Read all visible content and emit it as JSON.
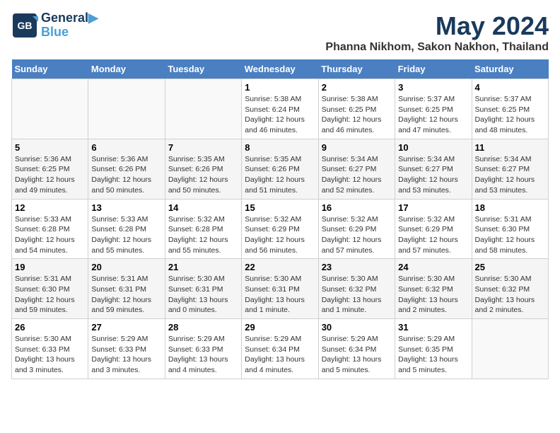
{
  "logo": {
    "text1": "General",
    "text2": "Blue"
  },
  "title": "May 2024",
  "location": "Phanna Nikhom, Sakon Nakhon, Thailand",
  "weekdays": [
    "Sunday",
    "Monday",
    "Tuesday",
    "Wednesday",
    "Thursday",
    "Friday",
    "Saturday"
  ],
  "weeks": [
    [
      {
        "day": "",
        "info": ""
      },
      {
        "day": "",
        "info": ""
      },
      {
        "day": "",
        "info": ""
      },
      {
        "day": "1",
        "info": "Sunrise: 5:38 AM\nSunset: 6:24 PM\nDaylight: 12 hours\nand 46 minutes."
      },
      {
        "day": "2",
        "info": "Sunrise: 5:38 AM\nSunset: 6:25 PM\nDaylight: 12 hours\nand 46 minutes."
      },
      {
        "day": "3",
        "info": "Sunrise: 5:37 AM\nSunset: 6:25 PM\nDaylight: 12 hours\nand 47 minutes."
      },
      {
        "day": "4",
        "info": "Sunrise: 5:37 AM\nSunset: 6:25 PM\nDaylight: 12 hours\nand 48 minutes."
      }
    ],
    [
      {
        "day": "5",
        "info": "Sunrise: 5:36 AM\nSunset: 6:25 PM\nDaylight: 12 hours\nand 49 minutes."
      },
      {
        "day": "6",
        "info": "Sunrise: 5:36 AM\nSunset: 6:26 PM\nDaylight: 12 hours\nand 50 minutes."
      },
      {
        "day": "7",
        "info": "Sunrise: 5:35 AM\nSunset: 6:26 PM\nDaylight: 12 hours\nand 50 minutes."
      },
      {
        "day": "8",
        "info": "Sunrise: 5:35 AM\nSunset: 6:26 PM\nDaylight: 12 hours\nand 51 minutes."
      },
      {
        "day": "9",
        "info": "Sunrise: 5:34 AM\nSunset: 6:27 PM\nDaylight: 12 hours\nand 52 minutes."
      },
      {
        "day": "10",
        "info": "Sunrise: 5:34 AM\nSunset: 6:27 PM\nDaylight: 12 hours\nand 53 minutes."
      },
      {
        "day": "11",
        "info": "Sunrise: 5:34 AM\nSunset: 6:27 PM\nDaylight: 12 hours\nand 53 minutes."
      }
    ],
    [
      {
        "day": "12",
        "info": "Sunrise: 5:33 AM\nSunset: 6:28 PM\nDaylight: 12 hours\nand 54 minutes."
      },
      {
        "day": "13",
        "info": "Sunrise: 5:33 AM\nSunset: 6:28 PM\nDaylight: 12 hours\nand 55 minutes."
      },
      {
        "day": "14",
        "info": "Sunrise: 5:32 AM\nSunset: 6:28 PM\nDaylight: 12 hours\nand 55 minutes."
      },
      {
        "day": "15",
        "info": "Sunrise: 5:32 AM\nSunset: 6:29 PM\nDaylight: 12 hours\nand 56 minutes."
      },
      {
        "day": "16",
        "info": "Sunrise: 5:32 AM\nSunset: 6:29 PM\nDaylight: 12 hours\nand 57 minutes."
      },
      {
        "day": "17",
        "info": "Sunrise: 5:32 AM\nSunset: 6:29 PM\nDaylight: 12 hours\nand 57 minutes."
      },
      {
        "day": "18",
        "info": "Sunrise: 5:31 AM\nSunset: 6:30 PM\nDaylight: 12 hours\nand 58 minutes."
      }
    ],
    [
      {
        "day": "19",
        "info": "Sunrise: 5:31 AM\nSunset: 6:30 PM\nDaylight: 12 hours\nand 59 minutes."
      },
      {
        "day": "20",
        "info": "Sunrise: 5:31 AM\nSunset: 6:31 PM\nDaylight: 12 hours\nand 59 minutes."
      },
      {
        "day": "21",
        "info": "Sunrise: 5:30 AM\nSunset: 6:31 PM\nDaylight: 13 hours\nand 0 minutes."
      },
      {
        "day": "22",
        "info": "Sunrise: 5:30 AM\nSunset: 6:31 PM\nDaylight: 13 hours\nand 1 minute."
      },
      {
        "day": "23",
        "info": "Sunrise: 5:30 AM\nSunset: 6:32 PM\nDaylight: 13 hours\nand 1 minute."
      },
      {
        "day": "24",
        "info": "Sunrise: 5:30 AM\nSunset: 6:32 PM\nDaylight: 13 hours\nand 2 minutes."
      },
      {
        "day": "25",
        "info": "Sunrise: 5:30 AM\nSunset: 6:32 PM\nDaylight: 13 hours\nand 2 minutes."
      }
    ],
    [
      {
        "day": "26",
        "info": "Sunrise: 5:30 AM\nSunset: 6:33 PM\nDaylight: 13 hours\nand 3 minutes."
      },
      {
        "day": "27",
        "info": "Sunrise: 5:29 AM\nSunset: 6:33 PM\nDaylight: 13 hours\nand 3 minutes."
      },
      {
        "day": "28",
        "info": "Sunrise: 5:29 AM\nSunset: 6:33 PM\nDaylight: 13 hours\nand 4 minutes."
      },
      {
        "day": "29",
        "info": "Sunrise: 5:29 AM\nSunset: 6:34 PM\nDaylight: 13 hours\nand 4 minutes."
      },
      {
        "day": "30",
        "info": "Sunrise: 5:29 AM\nSunset: 6:34 PM\nDaylight: 13 hours\nand 5 minutes."
      },
      {
        "day": "31",
        "info": "Sunrise: 5:29 AM\nSunset: 6:35 PM\nDaylight: 13 hours\nand 5 minutes."
      },
      {
        "day": "",
        "info": ""
      }
    ]
  ]
}
